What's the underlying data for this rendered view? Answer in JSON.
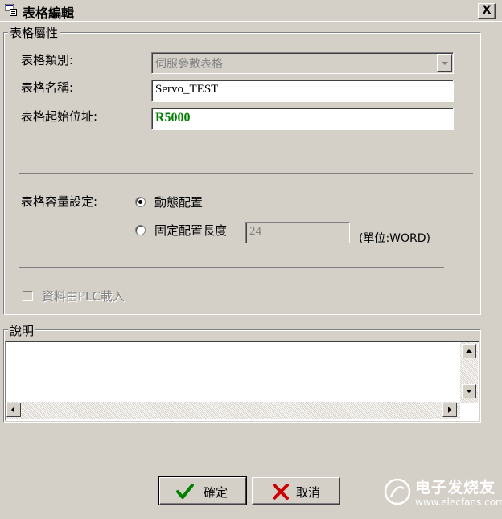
{
  "window": {
    "title": "表格編輯",
    "close_label": "X"
  },
  "group_properties": {
    "label": "表格屬性",
    "type_label": "表格類別:",
    "type_value": "伺服參數表格",
    "name_label": "表格名稱:",
    "name_value": "Servo_TEST",
    "start_label": "表格起始位址:",
    "start_value": "R5000",
    "capacity_label": "表格容量設定:",
    "dynamic_label": "動態配置",
    "fixed_label": "固定配置長度",
    "fixed_value": "24",
    "unit_label": "(單位:WORD)",
    "load_plc_label": "資料由PLC載入"
  },
  "group_description": {
    "label": "說明",
    "value": ""
  },
  "buttons": {
    "ok_label": "確定",
    "cancel_label": "取消"
  },
  "watermark": {
    "title": "电子发烧友",
    "url": "www.elecfans.com"
  },
  "colors": {
    "start_value_color": "#008000",
    "face": "#d4d0c8"
  }
}
